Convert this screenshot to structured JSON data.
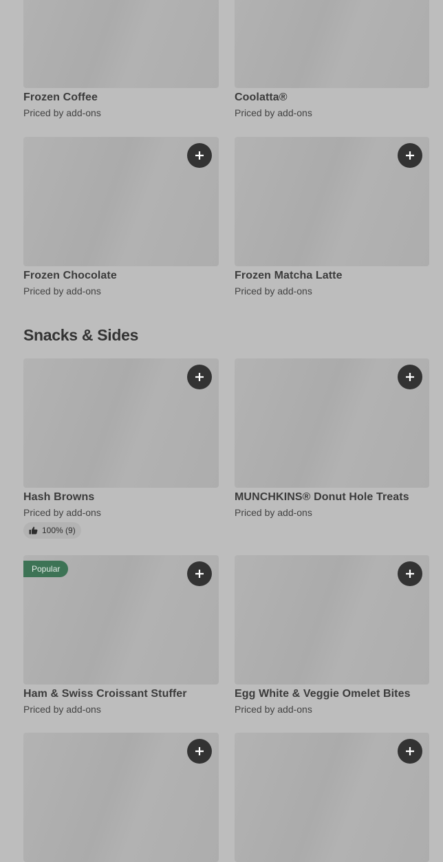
{
  "top_products": [
    {
      "name": "Frozen Coffee",
      "price": "Priced by add-ons"
    },
    {
      "name": "Coolatta®",
      "price": "Priced by add-ons"
    },
    {
      "name": "Frozen Chocolate",
      "price": "Priced by add-ons"
    },
    {
      "name": "Frozen Matcha Latte",
      "price": "Priced by add-ons"
    }
  ],
  "section": {
    "title": "Snacks & Sides"
  },
  "snacks": [
    {
      "name": "Hash Browns",
      "price": "Priced by add-ons",
      "rating": "100% (9)"
    },
    {
      "name": "MUNCHKINS® Donut Hole Treats",
      "price": "Priced by add-ons"
    },
    {
      "name": "Ham & Swiss Croissant Stuffer",
      "price": "Priced by add-ons",
      "badge": "Popular"
    },
    {
      "name": "Egg White & Veggie Omelet Bites",
      "price": "Priced by add-ons"
    }
  ],
  "icons": {
    "add": "plus-icon",
    "thumb": "thumbs-up-icon"
  },
  "colors": {
    "background": "#bdbdbd",
    "add_button": "#333333",
    "popular_badge": "#3d7355"
  }
}
